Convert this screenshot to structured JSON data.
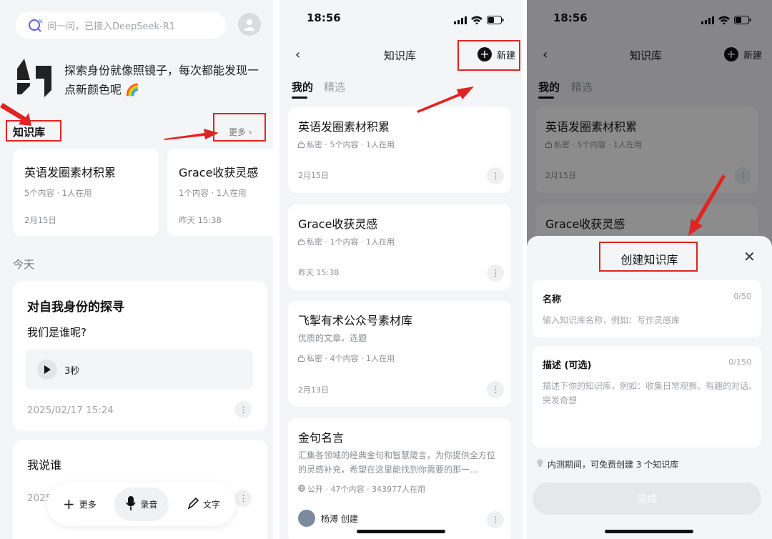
{
  "panel1": {
    "search_placeholder": "问一问，已接入DeepSeek-R1",
    "intro_text": "探索身份就像照镜子，每次都能发现一点新颜色呢 🌈",
    "section_title": "知识库",
    "more_label": "更多 ›",
    "kb_cards": [
      {
        "title": "英语发圈素材积累",
        "meta": "5个内容 · 1人在用",
        "date": "2月15日"
      },
      {
        "title": "Grace收获灵感",
        "meta": "1个内容 · 1人在用",
        "date": "昨天 15:38"
      }
    ],
    "today_label": "今天",
    "note1": {
      "title": "对自我身份的探寻",
      "subtitle": "我们是谁呢?",
      "audio_length": "3秒",
      "date": "2025/02/17 15:24"
    },
    "note2": {
      "title": "我说谁",
      "date": "2025"
    },
    "bottom_bar": {
      "more": "更多",
      "record": "录音",
      "text": "文字"
    }
  },
  "panel2": {
    "time": "18:56",
    "nav_title": "知识库",
    "new_label": "新建",
    "tab_mine": "我的",
    "tab_featured": "精选",
    "cards": [
      {
        "title": "英语发圈素材积累",
        "meta": "私密 · 5个内容 · 1人在用",
        "date": "2月15日"
      },
      {
        "title": "Grace收获灵感",
        "meta": "私密 · 1个内容 · 1人在用",
        "date": "昨天 15:38"
      },
      {
        "title": "飞掣有术公众号素材库",
        "desc": "优质的文章，选题",
        "meta": "私密 · 4个内容 · 1人在用",
        "date": "2月13日"
      },
      {
        "title": "金句名言",
        "desc": "汇集各领域的经典金句和智慧箴言，为你提供全方位的灵感补充，希望在这里能找到你需要的那一…",
        "meta": "公开 · 47个内容 · 343977人在用",
        "creator": "杨溥 创建"
      }
    ]
  },
  "panel3": {
    "time": "18:56",
    "nav_title": "知识库",
    "new_label": "新建",
    "tab_mine": "我的",
    "tab_featured": "精选",
    "cards": [
      {
        "title": "英语发圈素材积累",
        "meta": "私密 · 5个内容 · 1人在用",
        "date": "2月15日"
      },
      {
        "title": "Grace收获灵感"
      }
    ],
    "sheet": {
      "title": "创建知识库",
      "close": "✕",
      "name_label": "名称",
      "name_count": "0/50",
      "name_placeholder": "输入知识库名称，例如：写作灵感库",
      "desc_label": "描述 (可选)",
      "desc_count": "0/150",
      "desc_placeholder": "描述下你的知识库，例如：收集日常观察、有趣的对话、突发奇想",
      "beta_note": "内测期间，可免费创建 3 个知识库",
      "done_label": "完成"
    }
  },
  "colors": {
    "annotation_red": "#e02424",
    "text_dark": "#111111",
    "text_gray": "#8a8d92",
    "bg": "#f4f5f7"
  }
}
